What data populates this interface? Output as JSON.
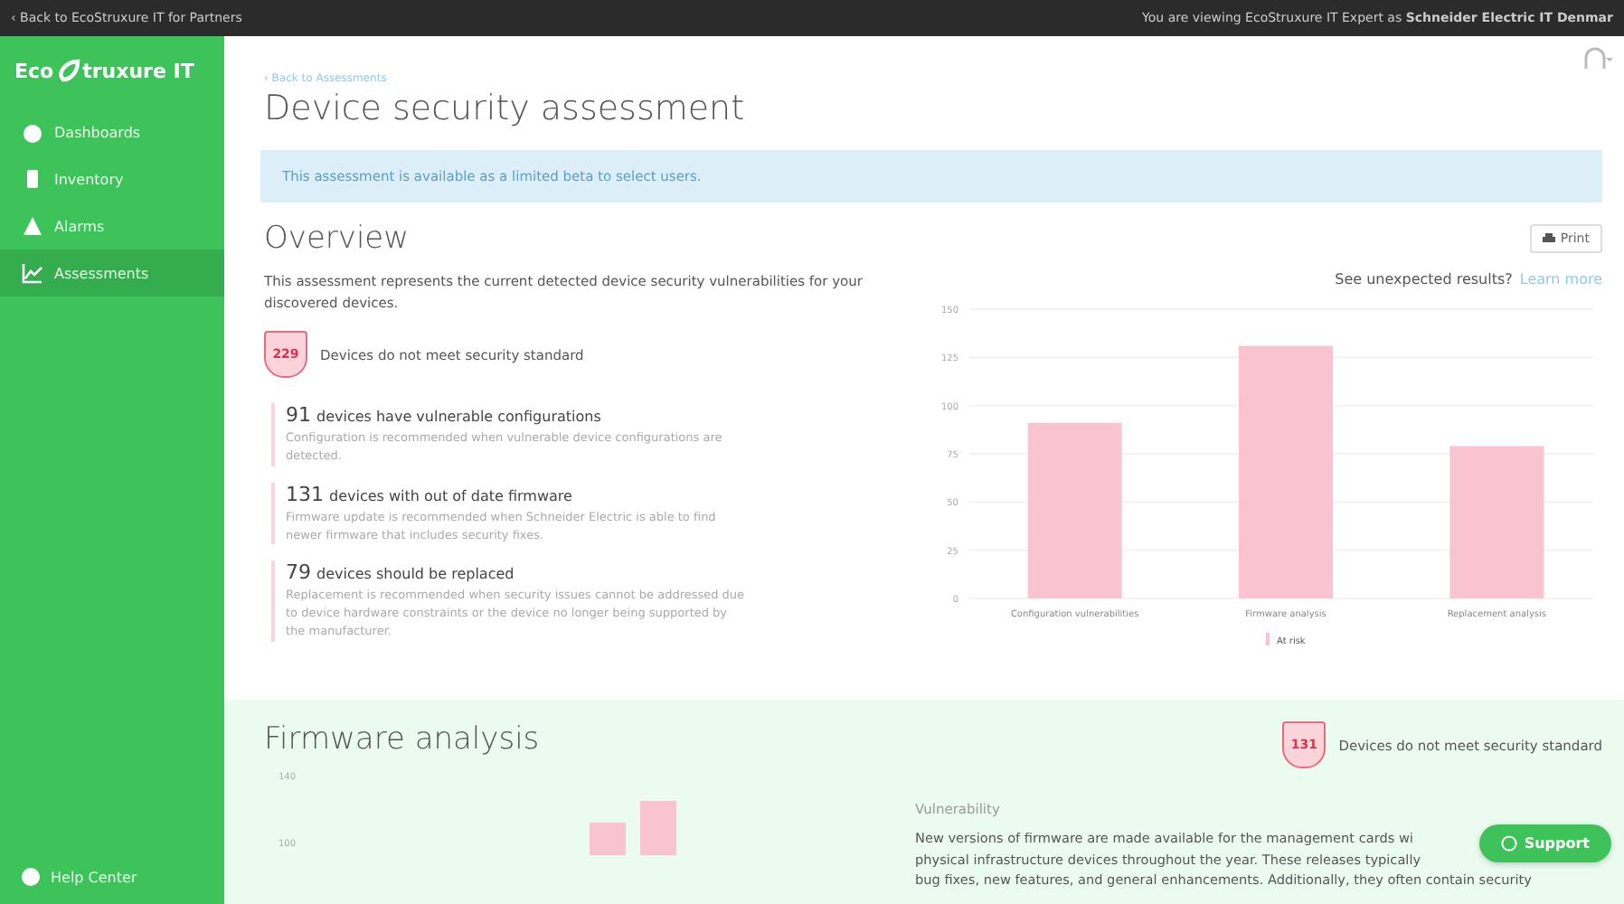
{
  "top_bar": {
    "back_link": "‹ Back to EcoStruxure IT for Partners",
    "viewing": "You are viewing EcoStruxure IT Expert as **Schneider Electric IT Denmar**"
  },
  "sidebar": {
    "logo_start": "Eco",
    "logo_end": "truxure IT",
    "items": [
      {
        "label": "Dashboards",
        "selected": false
      },
      {
        "label": "Inventory",
        "selected": false
      },
      {
        "label": "Alarms",
        "selected": false
      },
      {
        "label": "Assessments",
        "selected": true
      }
    ],
    "help": "Help Center"
  },
  "header": {
    "breadcrumb": "‹ Back to Assessments",
    "title": "Device security assessment"
  },
  "notice": "This assessment is available as a limited beta to select users.",
  "overview": {
    "title": "Overview",
    "print": "Print",
    "description": "This assessment represents the current detected device security vulnerabilities for your discovered devices.",
    "unexpected": "See unexpected results?",
    "learn_more": "Learn more",
    "summary": {
      "count": "229",
      "label": "Devices do not meet security standard"
    },
    "findings": [
      {
        "count": "91",
        "title": "devices have vulnerable configurations",
        "detail": "Configuration is recommended when vulnerable device configurations are detected."
      },
      {
        "count": "131",
        "title": "devices with out of date firmware",
        "detail": "Firmware update is recommended when Schneider Electric is able to find newer firmware that includes security fixes."
      },
      {
        "count": "79",
        "title": "devices should be replaced",
        "detail": "Replacement is recommended when security issues cannot be addressed due to device hardware constraints or the device no longer being supported by the manufacturer."
      }
    ],
    "chart_data": {
      "type": "bar",
      "categories": [
        "Configuration vulnerabilities",
        "Firmware analysis",
        "Replacement analysis"
      ],
      "series": [
        {
          "name": "At risk",
          "color": "#f9c3cf",
          "values": [
            91,
            131,
            79
          ]
        }
      ],
      "ylim": [
        0,
        150
      ],
      "grid": true,
      "yticks": [
        0,
        25,
        50,
        75,
        100,
        125,
        150
      ]
    }
  },
  "firmware": {
    "title": "Firmware analysis",
    "axis_labels": [
      "140",
      "100"
    ],
    "summary": {
      "count": "131",
      "label": "Devices do not meet security standard"
    },
    "subtitle": "Vulnerability",
    "lines": [
      "New versions of firmware are made available for the management cards wi",
      "physical infrastructure devices throughout the year. These releases typically",
      "bug fixes, new features, and general enhancements. Additionally, they often contain security"
    ]
  },
  "support": "Support"
}
